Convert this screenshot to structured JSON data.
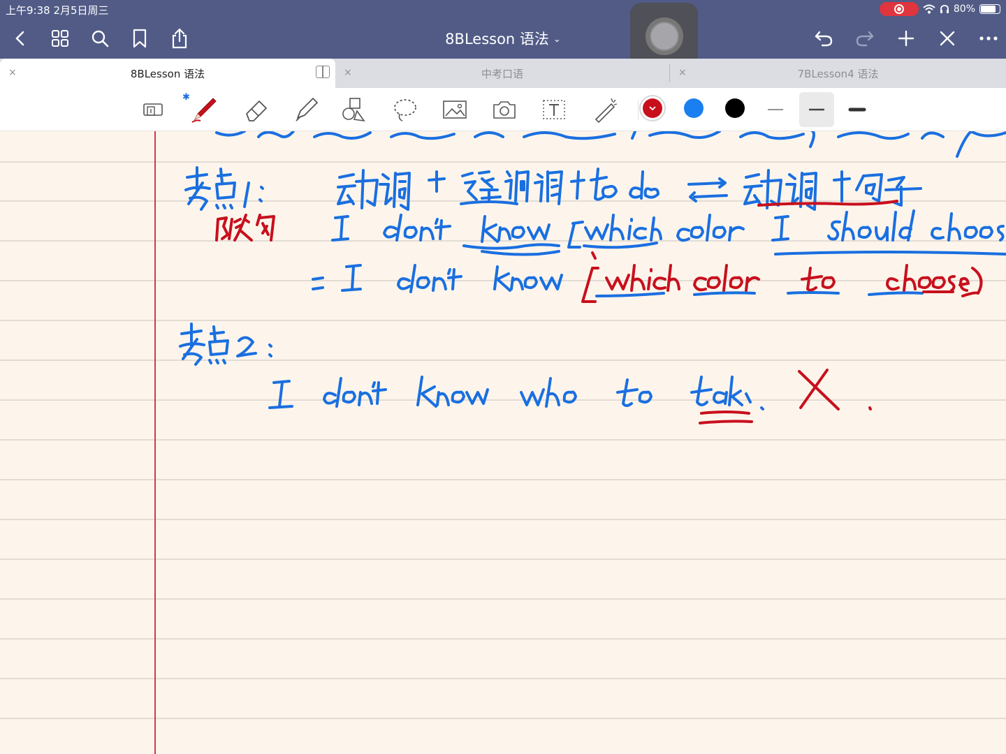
{
  "status_bar": {
    "time": "上午9:38  2月5日周三",
    "battery_text": "80%",
    "battery_level": 0.8
  },
  "nav": {
    "title": "8BLesson 语法",
    "title_chevron": "⌄"
  },
  "tabs": [
    {
      "label": "8BLesson 语法",
      "close": "×",
      "active": true
    },
    {
      "label": "中考口语",
      "close": "×",
      "active": false
    },
    {
      "label": "7BLesson4 语法",
      "close": "×",
      "active": false
    }
  ],
  "toolbar": {
    "bluetooth_mark": "✱",
    "colors": [
      "#c8101d",
      "#1a7ff0",
      "#000000"
    ],
    "active_color": "#c8101d",
    "tools": [
      "zoom-icon",
      "pen-icon",
      "eraser-icon",
      "highlighter-icon",
      "shapes-icon",
      "lasso-icon",
      "image-icon",
      "camera-icon",
      "text-icon",
      "laser-icon"
    ],
    "active_stroke": "medium"
  },
  "ink": {
    "blue": "#1a6fe0",
    "red": "#c8101d"
  }
}
